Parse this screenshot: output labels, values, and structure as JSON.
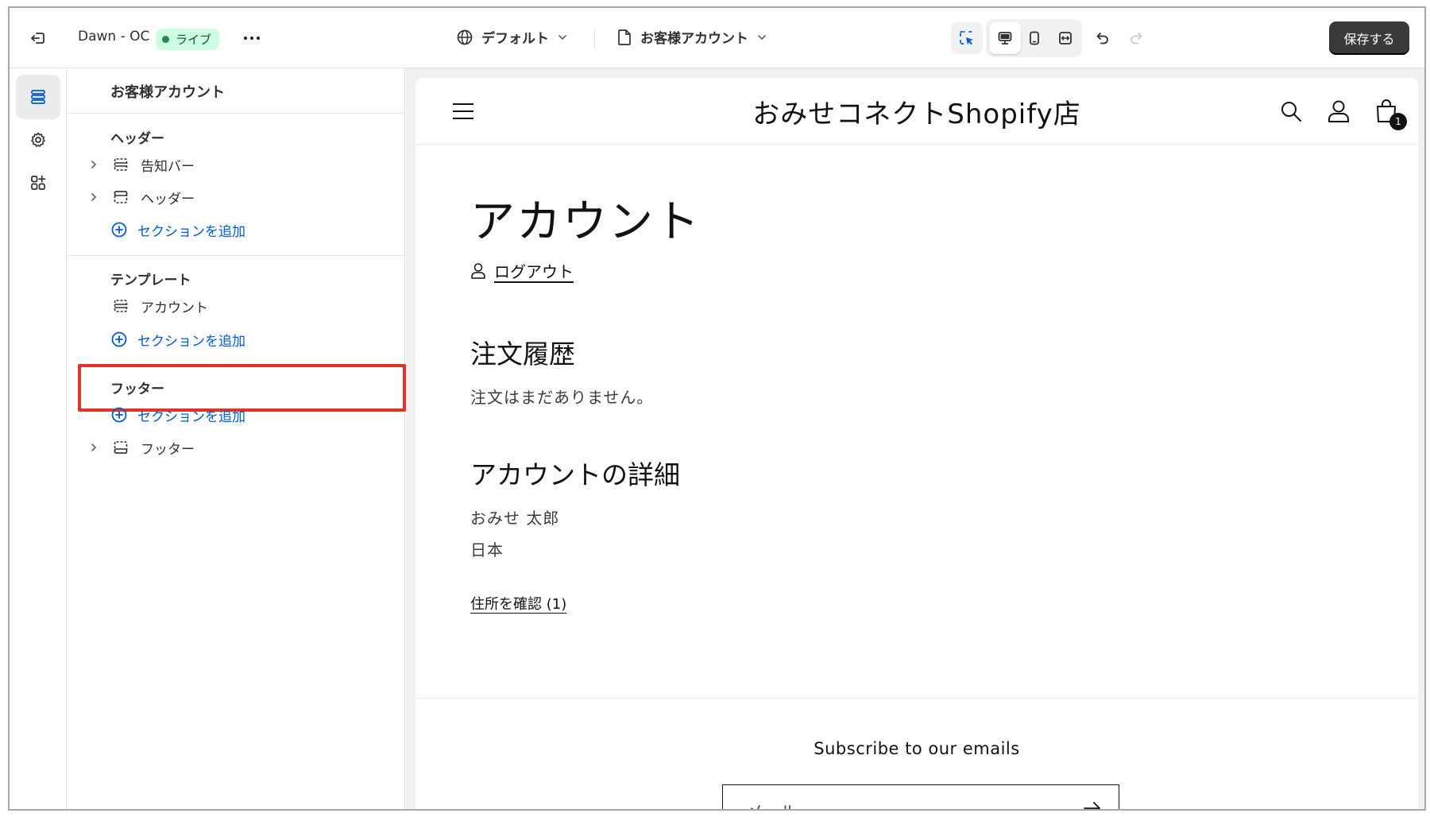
{
  "topbar": {
    "theme_name": "Dawn - OC",
    "live_label": "ライブ",
    "more_label": "•••",
    "locale_label": "デフォルト",
    "template_label": "お客様アカウント",
    "save_label": "保存する"
  },
  "sidebar": {
    "title": "お客様アカウント",
    "header_group": {
      "heading": "ヘッダー",
      "items": [
        {
          "label": "告知バー",
          "icon": "section-icon"
        },
        {
          "label": "ヘッダー",
          "icon": "header-section-icon"
        }
      ],
      "add_label": "セクションを追加"
    },
    "template_group": {
      "heading": "テンプレート",
      "items": [
        {
          "label": "アカウント",
          "icon": "section-icon"
        }
      ],
      "add_label": "セクションを追加"
    },
    "footer_group": {
      "heading": "フッター",
      "add_label": "セクションを追加",
      "items": [
        {
          "label": "フッター",
          "icon": "footer-section-icon"
        }
      ]
    }
  },
  "preview": {
    "shop_name": "おみせコネクトShopify店",
    "cart_count": "1",
    "page_title": "アカウント",
    "logout_label": "ログアウト",
    "orders_heading": "注文履歴",
    "orders_empty": "注文はまだありません。",
    "details_heading": "アカウントの詳細",
    "customer_name": "おみせ 太郎",
    "customer_country": "日本",
    "addresses_link": "住所を確認 (1)",
    "subscribe_heading": "Subscribe to our emails",
    "email_placeholder": "メール"
  },
  "colors": {
    "accent": "#005bd3",
    "highlight": "#e33229",
    "live_badge_bg": "#cdfee1",
    "save_button_bg": "#3a3a3a"
  }
}
